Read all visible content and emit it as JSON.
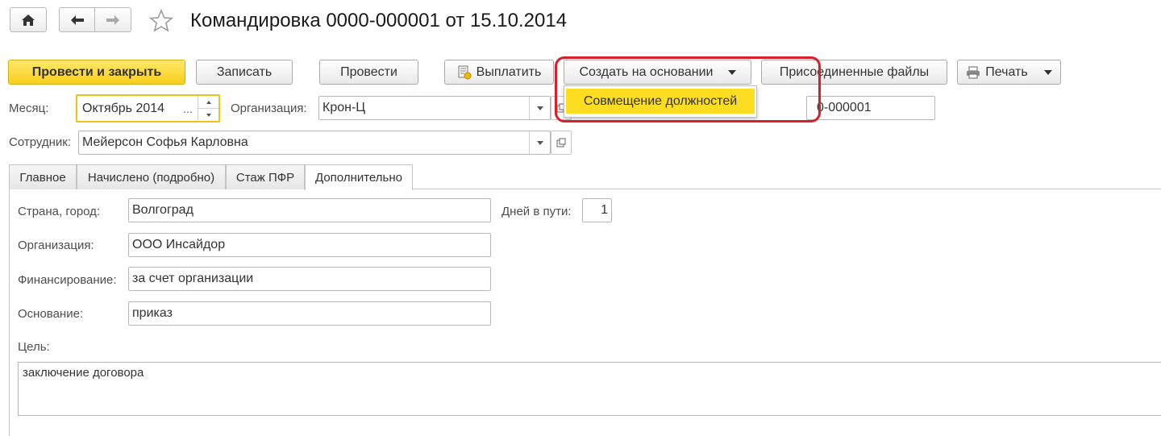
{
  "header": {
    "title": "Командировка 0000-000001 от 15.10.2014"
  },
  "toolbar": {
    "post_close": "Провести и закрыть",
    "save": "Записать",
    "post": "Провести",
    "pay": "Выплатить",
    "create_based_on": "Создать на основании",
    "attached_files": "Присоединенные файлы",
    "print": "Печать"
  },
  "menu": {
    "items": [
      {
        "label": "Совмещение должностей"
      }
    ]
  },
  "form": {
    "month_label": "Месяц:",
    "month_value": "Октябрь 2014",
    "month_ellipsis": "...",
    "org_label": "Организация:",
    "org_value": "Крон-Ц",
    "number_value": "0-000001",
    "employee_label": "Сотрудник:",
    "employee_value": "Мейерсон Софья Карловна"
  },
  "tabs": [
    {
      "label": "Главное"
    },
    {
      "label": "Начислено (подробно)"
    },
    {
      "label": "Стаж ПФР"
    },
    {
      "label": "Дополнительно"
    }
  ],
  "details": {
    "country_label": "Страна, город:",
    "country_value": "Волгоград",
    "days_label": "Дней в пути:",
    "days_value": "1",
    "organization_label": "Организация:",
    "organization_value": "ООО Инсайдор",
    "financing_label": "Финансирование:",
    "financing_value": "за счет организации",
    "basis_label": "Основание:",
    "basis_value": "приказ",
    "purpose_label": "Цель:",
    "purpose_value": "заключение договора"
  },
  "colors": {
    "primary_button": "#f8cf1e",
    "menu_highlight": "#fddd22",
    "annotation_frame": "#d9202a",
    "focus_border": "#f2c11a"
  }
}
